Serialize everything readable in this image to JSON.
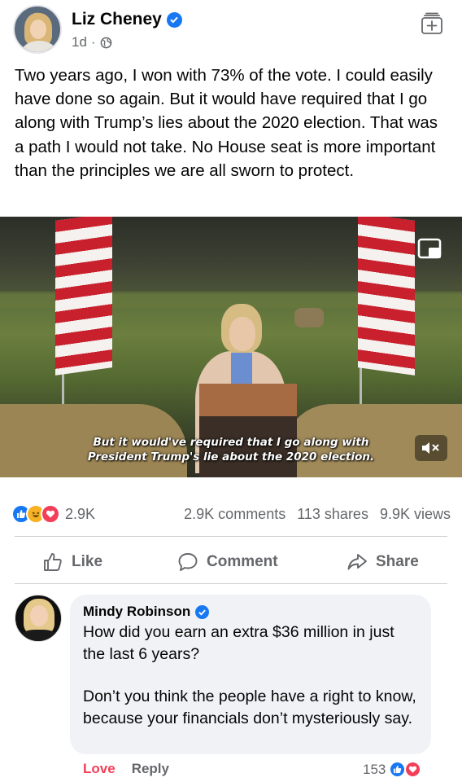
{
  "post": {
    "author": "Liz Cheney",
    "time": "1d",
    "separator": "·",
    "text": "Two years ago, I won with 73% of the vote. I could easily have done so again. But it would have required that I go along with Trump’s lies about the 2020 election. That was a path I would not take. No House seat is more important than the principles we are all sworn to protect."
  },
  "video": {
    "caption_line1": "But it would've required that I go along with",
    "caption_line2": "President Trump's lie about the 2020 election."
  },
  "stats": {
    "reactions": "2.9K",
    "comments": "2.9K comments",
    "shares": "113 shares",
    "views": "9.9K views"
  },
  "actions": {
    "like": "Like",
    "comment": "Comment",
    "share": "Share"
  },
  "comment": {
    "author": "Mindy Robinson",
    "paragraph1": "How did you earn an extra $36 million in just the last 6 years?",
    "paragraph2": "Don’t you think the people have a right to know, because your financials don’t mysteriously say.",
    "love_label": "Love",
    "reply_label": "Reply",
    "reaction_count": "153"
  },
  "colors": {
    "brand_blue": "#1877f2",
    "love_red": "#f33e58",
    "secondary_text": "#65676b"
  },
  "icons": {
    "verified": "verified-badge-icon",
    "globe": "globe-icon",
    "save": "save-post-icon",
    "pip": "picture-in-picture-icon",
    "mute": "muted-speaker-icon",
    "like": "thumbs-up-icon",
    "comment": "speech-bubble-icon",
    "share": "share-arrow-icon"
  }
}
